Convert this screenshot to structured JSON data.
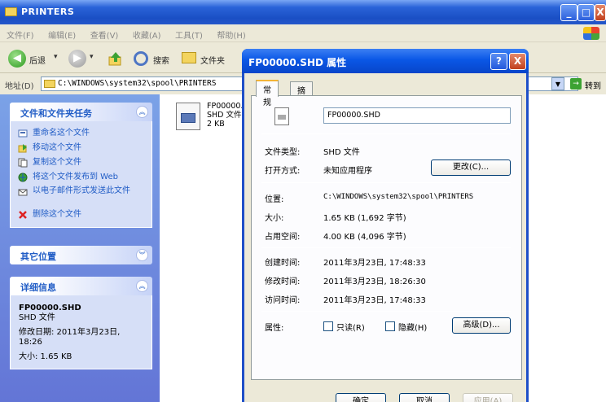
{
  "window": {
    "title": "PRINTERS",
    "buttons": {
      "minimize": "_",
      "maximize": "□",
      "close": "X"
    }
  },
  "menu": [
    "文件(F)",
    "编辑(E)",
    "查看(V)",
    "收藏(A)",
    "工具(T)",
    "帮助(H)"
  ],
  "toolbar": {
    "back": "后退",
    "back_arrow": "◀",
    "forward_arrow": "▶",
    "dropdown": "▾",
    "search": "搜索",
    "folders": "文件夹"
  },
  "address": {
    "label": "地址(D)",
    "path": "C:\\WINDOWS\\system32\\spool\\PRINTERS",
    "dropdown": "▼",
    "go": "转到",
    "go_arrow": "→"
  },
  "left_pane": {
    "file_tasks": {
      "title": "文件和文件夹任务",
      "chevron": "︽",
      "items": [
        {
          "label": "重命名这个文件"
        },
        {
          "label": "移动这个文件"
        },
        {
          "label": "复制这个文件"
        },
        {
          "label": "将这个文件发布到 Web"
        },
        {
          "label": "以电子邮件形式发送此文件"
        },
        {
          "label": "删除这个文件"
        }
      ]
    },
    "other_places": {
      "title": "其它位置",
      "chevron": "︾"
    },
    "details": {
      "title": "详细信息",
      "chevron": "︽",
      "name": "FP00000.SHD",
      "type": "SHD 文件",
      "modified": "修改日期: 2011年3月23日, 18:26",
      "size": "大小: 1.65 KB"
    }
  },
  "file": {
    "name": "FP00000.",
    "type": "SHD 文件",
    "size": "2 KB"
  },
  "dialog": {
    "title": "FP00000.SHD 属性",
    "help": "?",
    "close": "X",
    "tabs": [
      "常规",
      "摘要"
    ],
    "filename": "FP00000.SHD",
    "rows": {
      "type_label": "文件类型:",
      "type_value": "SHD 文件",
      "opens_label": "打开方式:",
      "opens_value": "未知应用程序",
      "change_button": "更改(C)...",
      "location_label": "位置:",
      "location_value": "C:\\WINDOWS\\system32\\spool\\PRINTERS",
      "size_label": "大小:",
      "size_value": "1.65 KB (1,692 字节)",
      "disk_label": "占用空间:",
      "disk_value": "4.00 KB (4,096 字节)",
      "created_label": "创建时间:",
      "created_value": "2011年3月23日, 17:48:33",
      "modified_label": "修改时间:",
      "modified_value": "2011年3月23日, 18:26:30",
      "accessed_label": "访问时间:",
      "accessed_value": "2011年3月23日, 17:48:33",
      "attr_label": "属性:",
      "readonly": "只读(R)",
      "hidden": "隐藏(H)",
      "advanced_button": "高级(D)..."
    },
    "footer": {
      "ok": "确定",
      "cancel": "取消",
      "apply": "应用(A)"
    }
  },
  "colors": {
    "title_blue": "#2457c9",
    "task_blue": "#215dc6",
    "pane_bg": "#7ba2e7",
    "dialog_bg": "#ece9d8"
  }
}
